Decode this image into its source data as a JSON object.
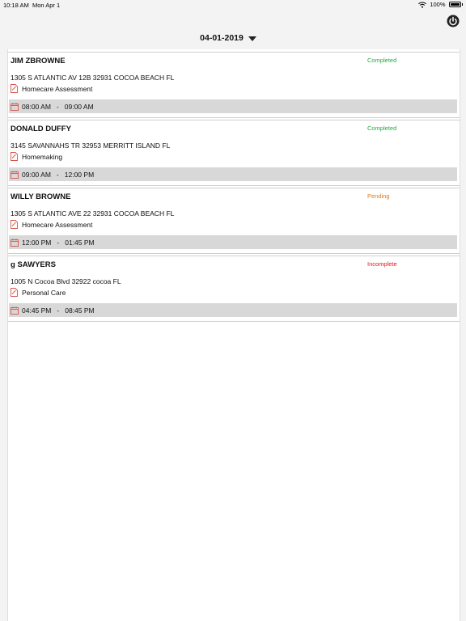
{
  "status_bar": {
    "time": "10:18 AM",
    "date": "Mon Apr 1",
    "battery": "100%"
  },
  "header": {
    "selected_date": "04-01-2019"
  },
  "colors": {
    "completed": "#27a844",
    "pending": "#e07b1a",
    "incomplete": "#e0151b",
    "icon": "#d8544a"
  },
  "appointments": [
    {
      "name": "JIM ZBROWNE",
      "status": "Completed",
      "address": "1305 S ATLANTIC AV 12B 32931 COCOA BEACH FL",
      "service": "Homecare Assessment",
      "start": "08:00 AM",
      "sep": "-",
      "end": "09:00 AM"
    },
    {
      "name": "DONALD DUFFY",
      "status": "Completed",
      "address": "3145 SAVANNAHS TR 32953 MERRITT ISLAND FL",
      "service": "Homemaking",
      "start": "09:00 AM",
      "sep": "-",
      "end": "12:00 PM"
    },
    {
      "name": "WILLY BROWNE",
      "status": "Pending",
      "address": "1305 S ATLANTIC AVE 22 32931 COCOA BEACH FL",
      "service": "Homecare Assessment",
      "start": "12:00 PM",
      "sep": "-",
      "end": "01:45 PM"
    },
    {
      "name": "g SAWYERS",
      "status": "Incomplete",
      "address": "1005 N Cocoa Blvd 32922 cocoa FL",
      "service": "Personal Care",
      "start": "04:45 PM",
      "sep": "-",
      "end": "08:45 PM"
    }
  ]
}
